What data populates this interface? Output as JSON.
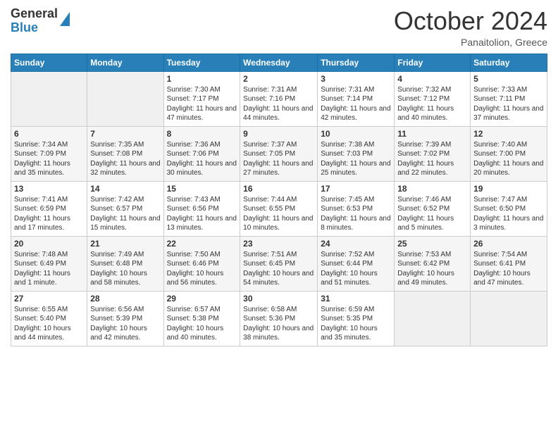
{
  "header": {
    "logo_line1": "General",
    "logo_line2": "Blue",
    "month_title": "October 2024",
    "subtitle": "Panaitolion, Greece"
  },
  "days_of_week": [
    "Sunday",
    "Monday",
    "Tuesday",
    "Wednesday",
    "Thursday",
    "Friday",
    "Saturday"
  ],
  "weeks": [
    [
      {
        "day": "",
        "info": ""
      },
      {
        "day": "",
        "info": ""
      },
      {
        "day": "1",
        "info": "Sunrise: 7:30 AM\nSunset: 7:17 PM\nDaylight: 11 hours and 47 minutes."
      },
      {
        "day": "2",
        "info": "Sunrise: 7:31 AM\nSunset: 7:16 PM\nDaylight: 11 hours and 44 minutes."
      },
      {
        "day": "3",
        "info": "Sunrise: 7:31 AM\nSunset: 7:14 PM\nDaylight: 11 hours and 42 minutes."
      },
      {
        "day": "4",
        "info": "Sunrise: 7:32 AM\nSunset: 7:12 PM\nDaylight: 11 hours and 40 minutes."
      },
      {
        "day": "5",
        "info": "Sunrise: 7:33 AM\nSunset: 7:11 PM\nDaylight: 11 hours and 37 minutes."
      }
    ],
    [
      {
        "day": "6",
        "info": "Sunrise: 7:34 AM\nSunset: 7:09 PM\nDaylight: 11 hours and 35 minutes."
      },
      {
        "day": "7",
        "info": "Sunrise: 7:35 AM\nSunset: 7:08 PM\nDaylight: 11 hours and 32 minutes."
      },
      {
        "day": "8",
        "info": "Sunrise: 7:36 AM\nSunset: 7:06 PM\nDaylight: 11 hours and 30 minutes."
      },
      {
        "day": "9",
        "info": "Sunrise: 7:37 AM\nSunset: 7:05 PM\nDaylight: 11 hours and 27 minutes."
      },
      {
        "day": "10",
        "info": "Sunrise: 7:38 AM\nSunset: 7:03 PM\nDaylight: 11 hours and 25 minutes."
      },
      {
        "day": "11",
        "info": "Sunrise: 7:39 AM\nSunset: 7:02 PM\nDaylight: 11 hours and 22 minutes."
      },
      {
        "day": "12",
        "info": "Sunrise: 7:40 AM\nSunset: 7:00 PM\nDaylight: 11 hours and 20 minutes."
      }
    ],
    [
      {
        "day": "13",
        "info": "Sunrise: 7:41 AM\nSunset: 6:59 PM\nDaylight: 11 hours and 17 minutes."
      },
      {
        "day": "14",
        "info": "Sunrise: 7:42 AM\nSunset: 6:57 PM\nDaylight: 11 hours and 15 minutes."
      },
      {
        "day": "15",
        "info": "Sunrise: 7:43 AM\nSunset: 6:56 PM\nDaylight: 11 hours and 13 minutes."
      },
      {
        "day": "16",
        "info": "Sunrise: 7:44 AM\nSunset: 6:55 PM\nDaylight: 11 hours and 10 minutes."
      },
      {
        "day": "17",
        "info": "Sunrise: 7:45 AM\nSunset: 6:53 PM\nDaylight: 11 hours and 8 minutes."
      },
      {
        "day": "18",
        "info": "Sunrise: 7:46 AM\nSunset: 6:52 PM\nDaylight: 11 hours and 5 minutes."
      },
      {
        "day": "19",
        "info": "Sunrise: 7:47 AM\nSunset: 6:50 PM\nDaylight: 11 hours and 3 minutes."
      }
    ],
    [
      {
        "day": "20",
        "info": "Sunrise: 7:48 AM\nSunset: 6:49 PM\nDaylight: 11 hours and 1 minute."
      },
      {
        "day": "21",
        "info": "Sunrise: 7:49 AM\nSunset: 6:48 PM\nDaylight: 10 hours and 58 minutes."
      },
      {
        "day": "22",
        "info": "Sunrise: 7:50 AM\nSunset: 6:46 PM\nDaylight: 10 hours and 56 minutes."
      },
      {
        "day": "23",
        "info": "Sunrise: 7:51 AM\nSunset: 6:45 PM\nDaylight: 10 hours and 54 minutes."
      },
      {
        "day": "24",
        "info": "Sunrise: 7:52 AM\nSunset: 6:44 PM\nDaylight: 10 hours and 51 minutes."
      },
      {
        "day": "25",
        "info": "Sunrise: 7:53 AM\nSunset: 6:42 PM\nDaylight: 10 hours and 49 minutes."
      },
      {
        "day": "26",
        "info": "Sunrise: 7:54 AM\nSunset: 6:41 PM\nDaylight: 10 hours and 47 minutes."
      }
    ],
    [
      {
        "day": "27",
        "info": "Sunrise: 6:55 AM\nSunset: 5:40 PM\nDaylight: 10 hours and 44 minutes."
      },
      {
        "day": "28",
        "info": "Sunrise: 6:56 AM\nSunset: 5:39 PM\nDaylight: 10 hours and 42 minutes."
      },
      {
        "day": "29",
        "info": "Sunrise: 6:57 AM\nSunset: 5:38 PM\nDaylight: 10 hours and 40 minutes."
      },
      {
        "day": "30",
        "info": "Sunrise: 6:58 AM\nSunset: 5:36 PM\nDaylight: 10 hours and 38 minutes."
      },
      {
        "day": "31",
        "info": "Sunrise: 6:59 AM\nSunset: 5:35 PM\nDaylight: 10 hours and 35 minutes."
      },
      {
        "day": "",
        "info": ""
      },
      {
        "day": "",
        "info": ""
      }
    ]
  ]
}
